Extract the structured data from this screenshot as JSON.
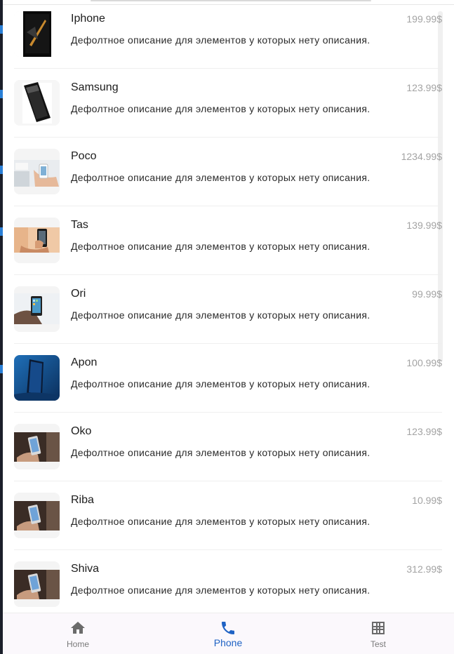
{
  "items": [
    {
      "name": "Iphone",
      "description": "Дефолтное описание для элементов у которых нету описания.",
      "price": "199.99$",
      "image": "phone-black-image"
    },
    {
      "name": "Samsung",
      "description": "Дефолтное описание для элементов у которых нету описания.",
      "price": "123.99$",
      "image": "phone-tilted-image"
    },
    {
      "name": "Poco",
      "description": "Дефолтное описание для элементов у которых нету описания.",
      "price": "1234.99$",
      "image": "phone-in-hand-desk-image"
    },
    {
      "name": "Tas",
      "description": "Дефолтное описание для элементов у которых нету описания.",
      "price": "139.99$",
      "image": "phone-hand-peach-image"
    },
    {
      "name": "Ori",
      "description": "Дефолтное описание для элементов у которых нету описания.",
      "price": "99.99$",
      "image": "phone-hand-white-image"
    },
    {
      "name": "Apon",
      "description": "Дефолтное описание для элементов у которых нету описания.",
      "price": "100.99$",
      "image": "phone-blue-image"
    },
    {
      "name": "Oko",
      "description": "Дефолтное описание для элементов у которых нету описания.",
      "price": "123.99$",
      "image": "phone-hand-dark-image"
    },
    {
      "name": "Riba",
      "description": "Дефолтное описание для элементов у которых нету описания.",
      "price": "10.99$",
      "image": "phone-hand-dark-image"
    },
    {
      "name": "Shiva",
      "description": "Дефолтное описание для элементов у которых нету описания.",
      "price": "312.99$",
      "image": "phone-hand-dark-image"
    }
  ],
  "nav": {
    "home": {
      "label": "Home",
      "icon": "home-icon"
    },
    "phone": {
      "label": "Phone",
      "icon": "phone-icon"
    },
    "test": {
      "label": "Test",
      "icon": "grid-icon"
    }
  },
  "colors": {
    "accent": "#1e62c4",
    "price": "#a3a3a3",
    "nav_background": "#fbf8fc"
  }
}
